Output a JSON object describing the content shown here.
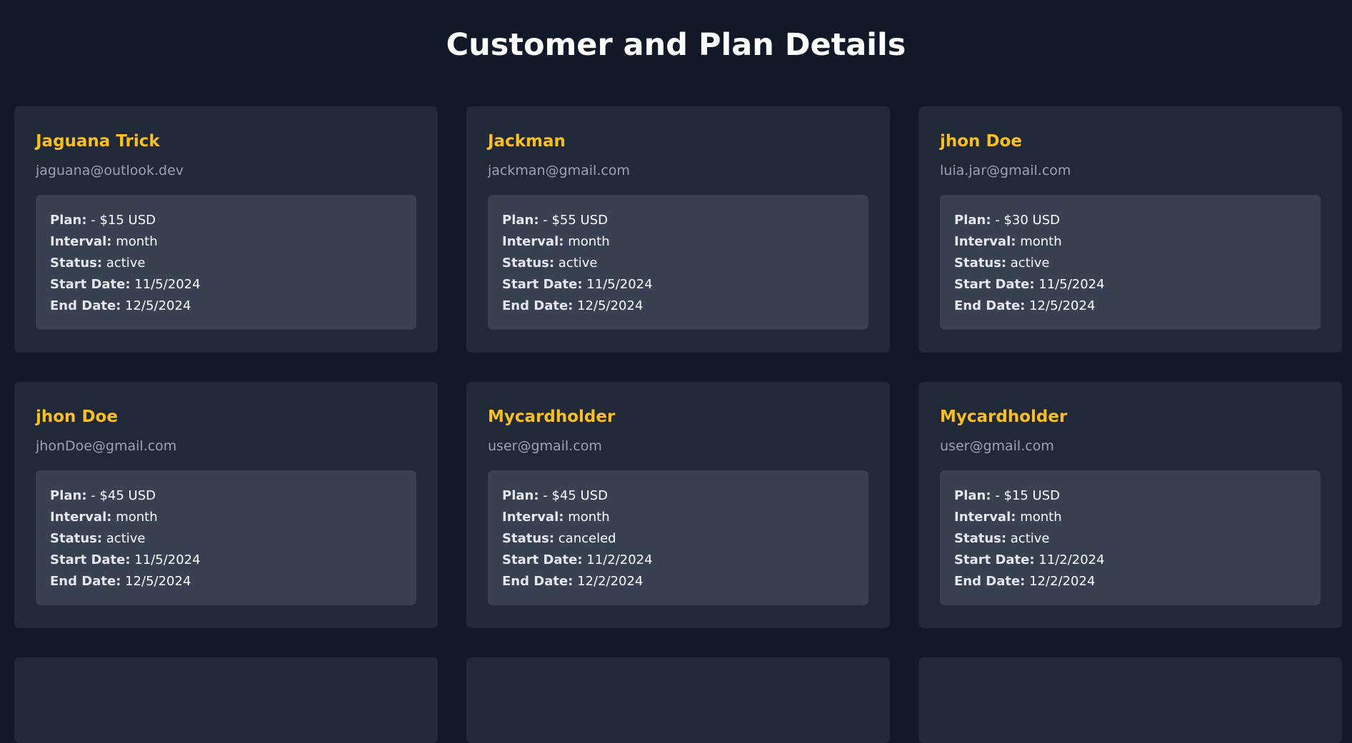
{
  "page": {
    "title": "Customer and Plan Details"
  },
  "labels": {
    "plan": "Plan:",
    "interval": "Interval:",
    "status": "Status:",
    "start_date": "Start Date:",
    "end_date": "End Date:"
  },
  "colors": {
    "background": "#111827",
    "card": "#1f2937",
    "plan_box": "#374151",
    "name_accent": "#fbbf24",
    "email": "#9ca3af"
  },
  "customers": [
    {
      "name": "Jaguana Trick",
      "email": "jaguana@outlook.dev",
      "plan": "- $15 USD",
      "interval": "month",
      "status": "active",
      "start_date": "11/5/2024",
      "end_date": "12/5/2024"
    },
    {
      "name": "Jackman",
      "email": "jackman@gmail.com",
      "plan": "- $55 USD",
      "interval": "month",
      "status": "active",
      "start_date": "11/5/2024",
      "end_date": "12/5/2024"
    },
    {
      "name": "jhon Doe",
      "email": "luia.jar@gmail.com",
      "plan": "- $30 USD",
      "interval": "month",
      "status": "active",
      "start_date": "11/5/2024",
      "end_date": "12/5/2024"
    },
    {
      "name": "jhon Doe",
      "email": "jhonDoe@gmail.com",
      "plan": "- $45 USD",
      "interval": "month",
      "status": "active",
      "start_date": "11/5/2024",
      "end_date": "12/5/2024"
    },
    {
      "name": "Mycardholder",
      "email": "user@gmail.com",
      "plan": "- $45 USD",
      "interval": "month",
      "status": "canceled",
      "start_date": "11/2/2024",
      "end_date": "12/2/2024"
    },
    {
      "name": "Mycardholder",
      "email": "user@gmail.com",
      "plan": "- $15 USD",
      "interval": "month",
      "status": "active",
      "start_date": "11/2/2024",
      "end_date": "12/2/2024"
    }
  ]
}
